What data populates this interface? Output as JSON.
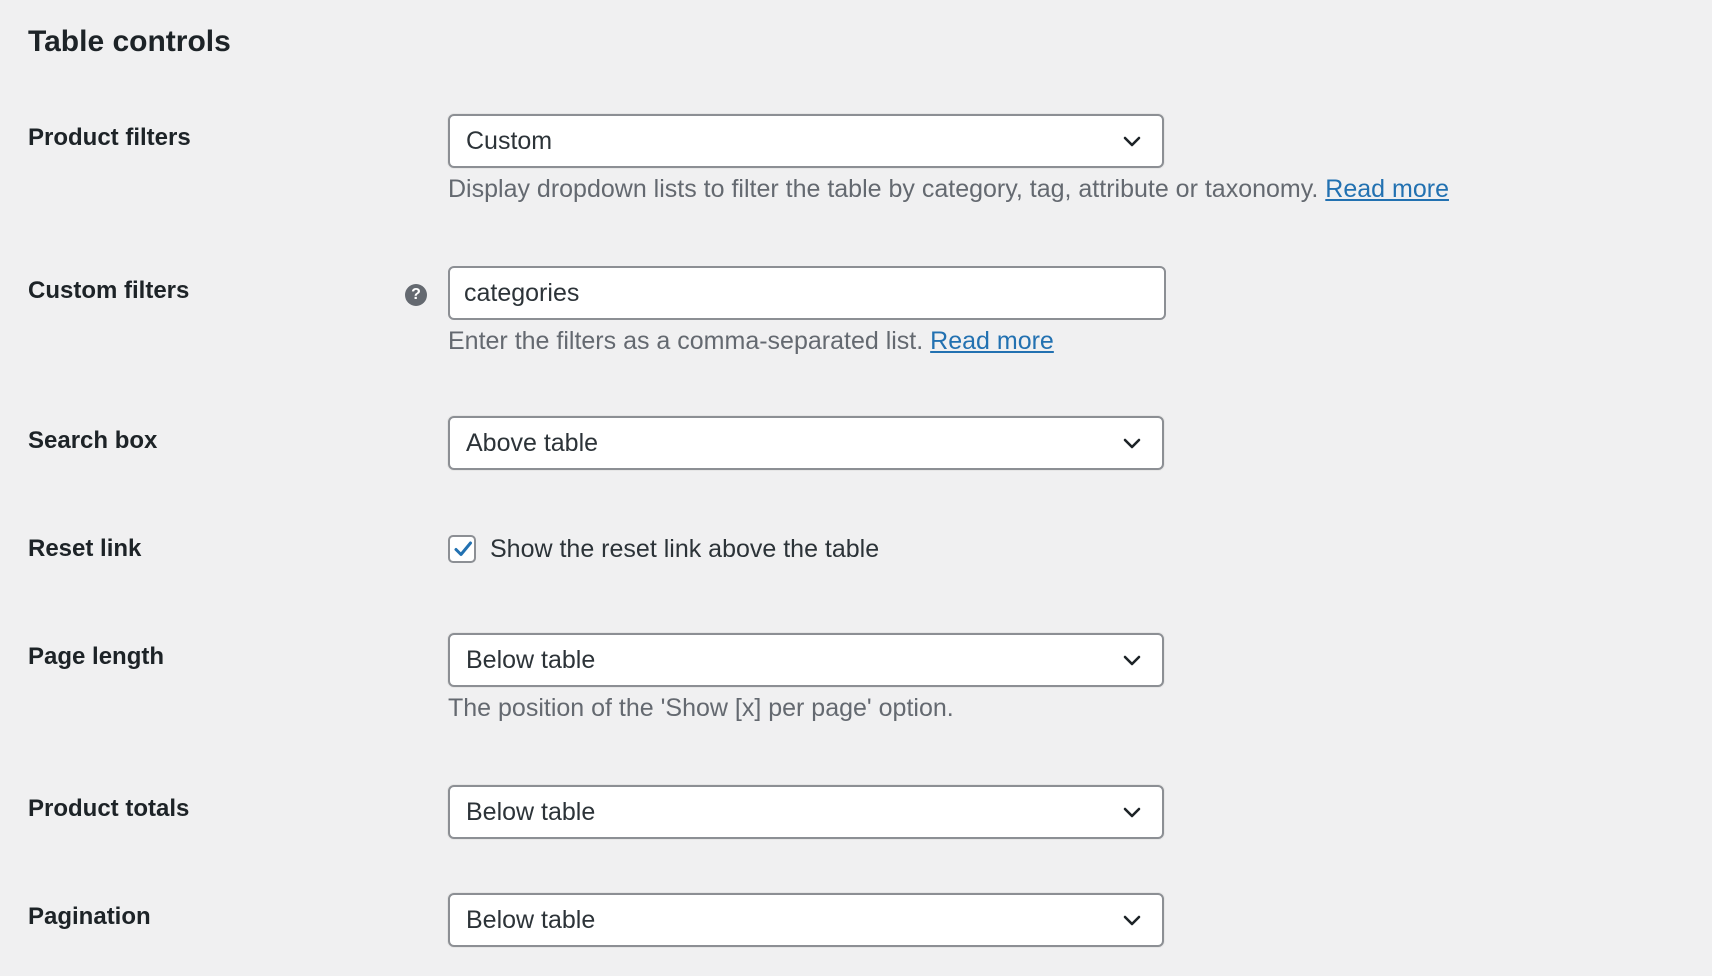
{
  "section": {
    "title": "Table controls"
  },
  "fields": {
    "product_filters": {
      "label": "Product filters",
      "value": "Custom",
      "description": "Display dropdown lists to filter the table by category, tag, attribute or taxonomy.",
      "link": "Read more"
    },
    "custom_filters": {
      "label": "Custom filters",
      "value": "categories",
      "help": "?",
      "description": "Enter the filters as a comma-separated list.",
      "link": "Read more"
    },
    "search_box": {
      "label": "Search box",
      "value": "Above table"
    },
    "reset_link": {
      "label": "Reset link",
      "checkbox_label": "Show the reset link above the table",
      "checked": true
    },
    "page_length": {
      "label": "Page length",
      "value": "Below table",
      "description": "The position of the 'Show [x] per page' option."
    },
    "product_totals": {
      "label": "Product totals",
      "value": "Below table"
    },
    "pagination": {
      "label": "Pagination",
      "value": "Below table"
    }
  },
  "icons": {
    "chevron": "chevron-down-icon",
    "help": "help-icon",
    "check": "checkmark-icon"
  },
  "colors": {
    "background": "#f0f0f1",
    "link": "#2271b1",
    "checkmark": "#2271b1",
    "description": "#646970",
    "border": "#8c8f94"
  }
}
